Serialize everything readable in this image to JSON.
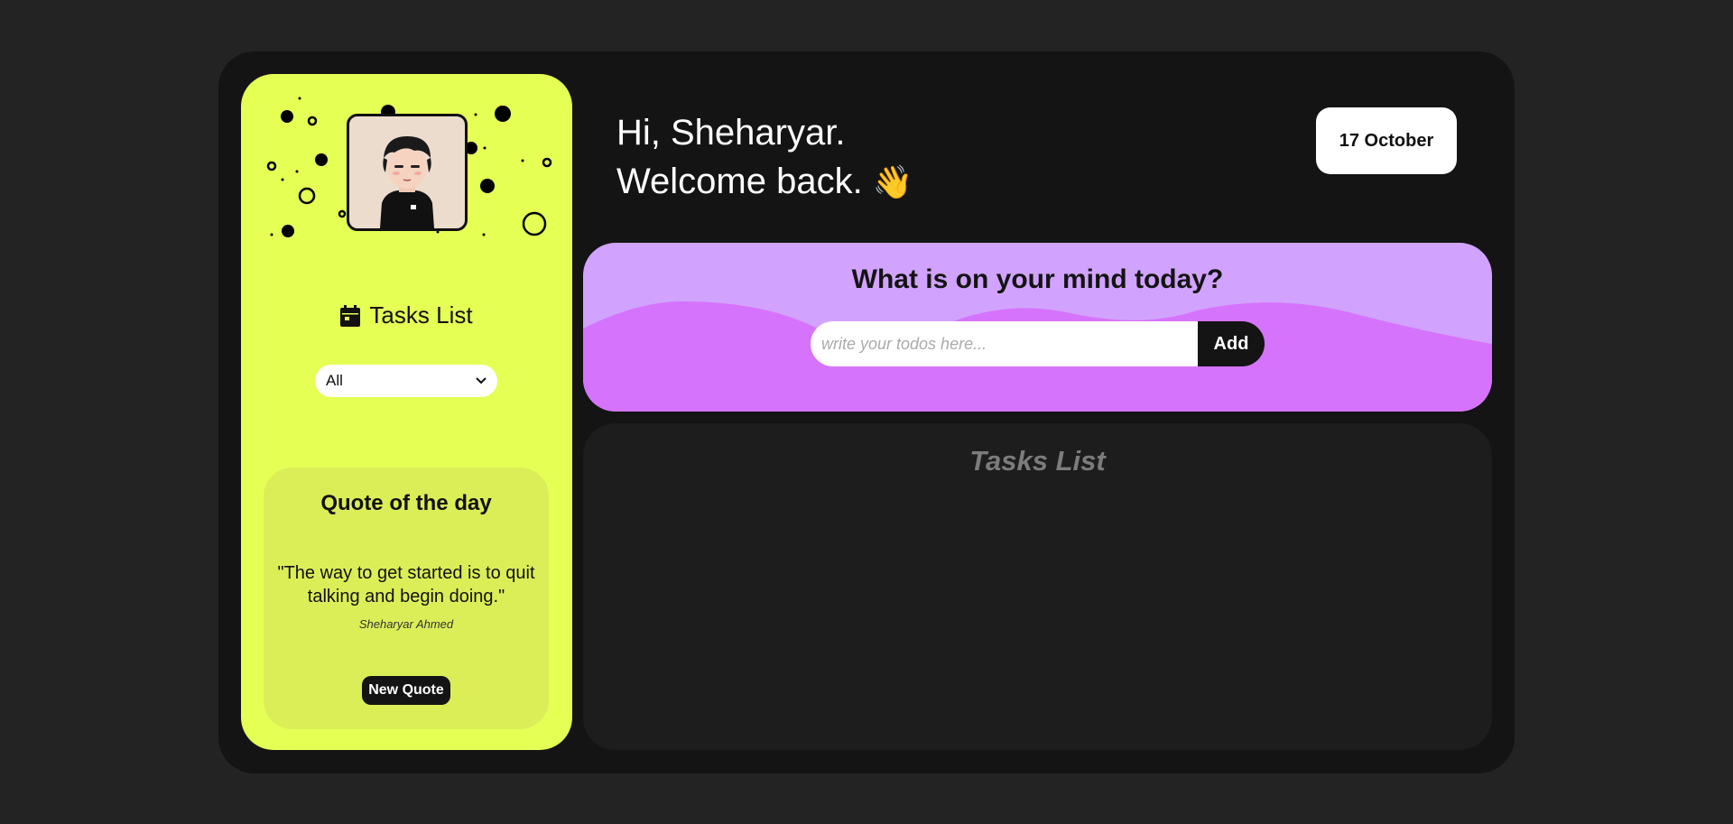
{
  "greeting": {
    "line1": "Hi, Sheharyar.",
    "line2": "Welcome back.",
    "emoji": "👋"
  },
  "date": "17 October",
  "sidebar": {
    "avatar_icon": "avatar-illustration",
    "tasks_heading": "Tasks List",
    "tasks_icon": "calendar-icon",
    "filter": {
      "selected": "All"
    },
    "quote": {
      "title": "Quote of the day",
      "text": "\"The way to get started is to quit talking and begin doing.\"",
      "author": "Sheharyar Ahmed",
      "button_label": "New Quote"
    }
  },
  "todo": {
    "prompt": "What is on your mind today?",
    "placeholder": "write your todos here...",
    "value": "",
    "add_label": "Add"
  },
  "task_panel": {
    "title": "Tasks List"
  },
  "colors": {
    "page_bg": "#232323",
    "app_bg": "#141414",
    "sidebar_bg": "#e6ff55",
    "quote_bg": "#dbee58",
    "mind_card_bg": "#d1a3ff",
    "mind_wave": "#d673fc",
    "panel_bg": "#1d1d1d"
  }
}
